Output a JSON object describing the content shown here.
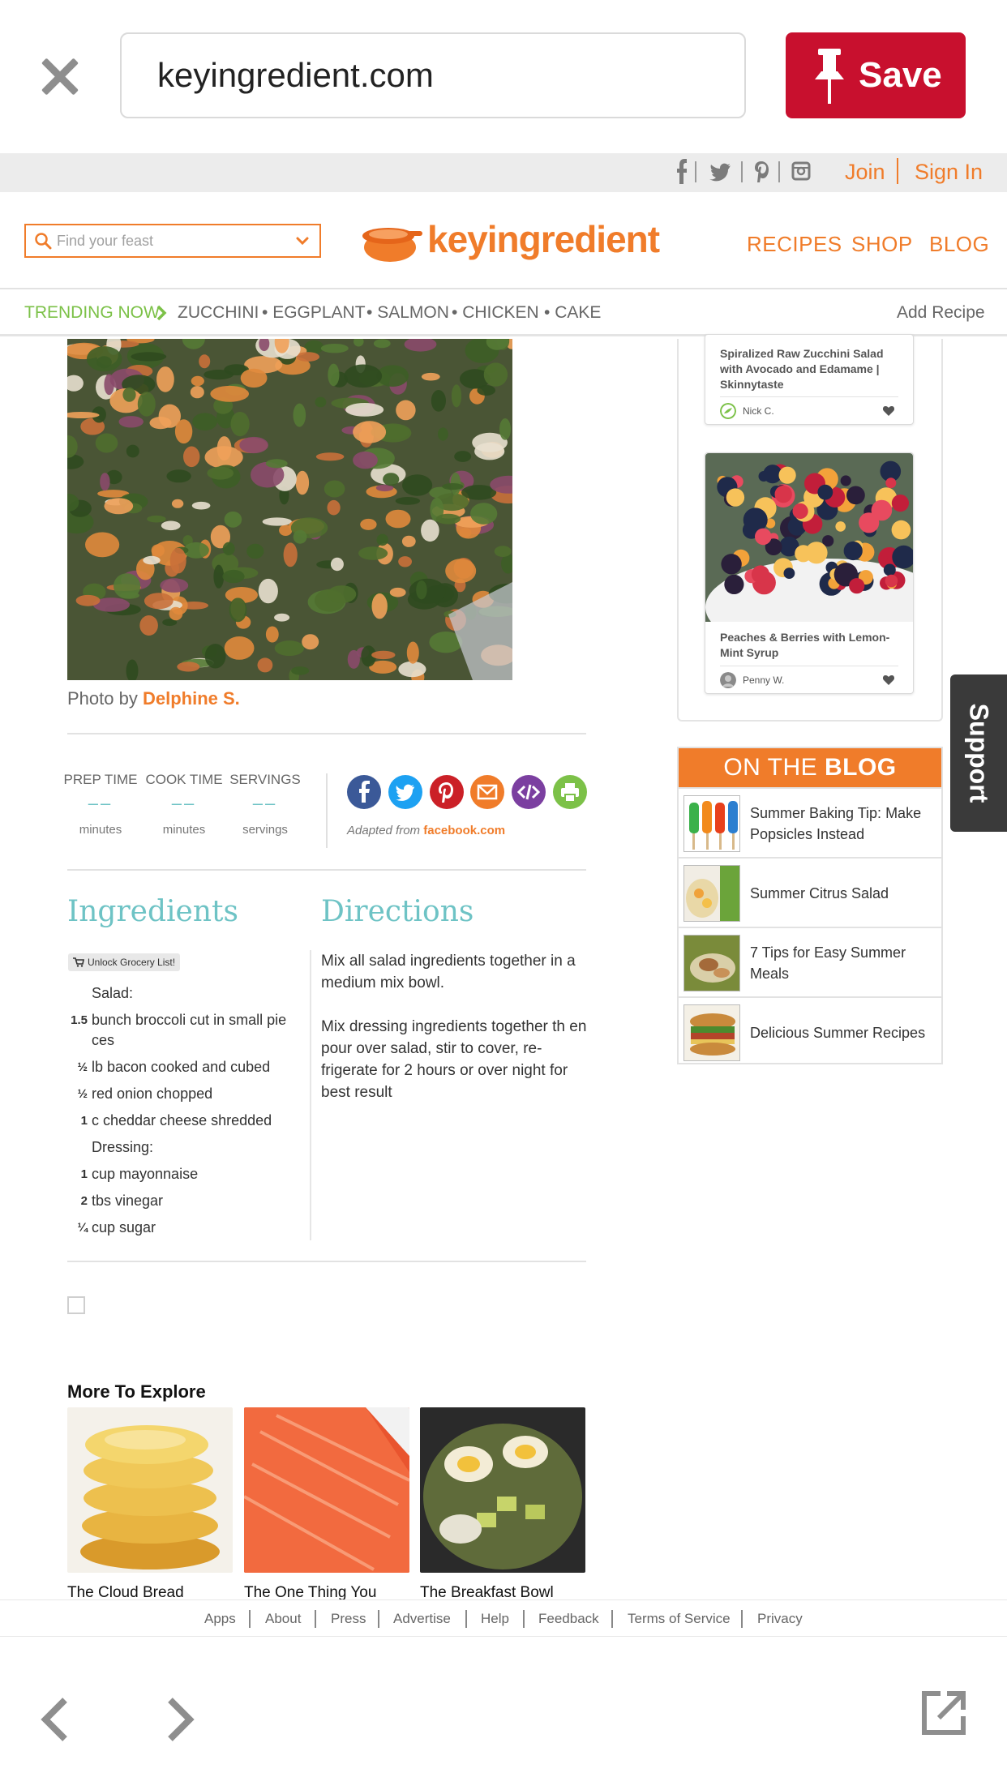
{
  "browser": {
    "url": "keyingredient.com",
    "save_label": "Save"
  },
  "account": {
    "join": "Join",
    "sign_in": "Sign In",
    "social_icons": [
      "facebook-icon",
      "twitter-icon",
      "pinterest-icon",
      "instagram-icon"
    ]
  },
  "header": {
    "search_placeholder": "Find your feast",
    "logo_text": "keyingredient",
    "nav": [
      "RECIPES",
      "SHOP",
      "BLOG"
    ]
  },
  "trending": {
    "label": "TRENDING NOW",
    "items": [
      "ZUCCHINI",
      "EGGPLANT",
      "SALMON",
      "CHICKEN",
      "CAKE"
    ],
    "add_recipe": "Add Recipe"
  },
  "recipe": {
    "photo_credit_prefix": "Photo by",
    "photo_credit_name": "Delphine S.",
    "times": [
      {
        "label": "PREP TIME",
        "value": "––",
        "unit": "minutes"
      },
      {
        "label": "COOK TIME",
        "value": "––",
        "unit": "minutes"
      },
      {
        "label": "SERVINGS",
        "value": "––",
        "unit": "servings"
      }
    ],
    "share_icons": [
      "facebook-icon",
      "twitter-icon",
      "pinterest-icon",
      "email-icon",
      "embed-icon",
      "print-icon"
    ],
    "share_colors": [
      "#3b5998",
      "#1da1f2",
      "#cb2027",
      "#f07c2a",
      "#7b3fa0",
      "#7cc148"
    ],
    "adapted_prefix": "Adapted from",
    "adapted_source": "facebook.com",
    "ingredients_heading": "Ingredients",
    "directions_heading": "Directions",
    "grocery_button": "Unlock Grocery List!",
    "ingredients": [
      {
        "qty": "",
        "text": "Salad:"
      },
      {
        "qty": "1.5",
        "text": "bunch broccoli cut in small pie ces"
      },
      {
        "qty": "½",
        "text": "lb bacon cooked and cubed"
      },
      {
        "qty": "½",
        "text": "red onion chopped"
      },
      {
        "qty": "1",
        "text": "c cheddar cheese shredded"
      },
      {
        "qty": "",
        "text": "Dressing:"
      },
      {
        "qty": "1",
        "text": "cup mayonnaise"
      },
      {
        "qty": "2",
        "text": "tbs vinegar"
      },
      {
        "qty": "¼",
        "text": "cup sugar"
      }
    ],
    "directions": [
      "Mix all salad ingredients together in a medium mix bowl.",
      "Mix dressing ingredients together th en pour over salad, stir to cover, re-frigerate for 2 hours or over night for best result"
    ]
  },
  "more": {
    "heading": "More To Explore",
    "items": [
      "The Cloud Bread",
      "The One Thing You",
      "The Breakfast Bowl"
    ]
  },
  "sidebar": {
    "cards": [
      {
        "title": "Spiralized Raw Zucchini Salad with Avocado and Edamame | Skinnytaste",
        "user": "Nick C."
      },
      {
        "title": "Peaches & Berries with Lemon-Mint Syrup",
        "user": "Penny W."
      }
    ],
    "blog_heading_light": "ON THE",
    "blog_heading_bold": "BLOG",
    "blog_posts": [
      "Summer Baking Tip: Make Popsicles Instead",
      "Summer Citrus Salad",
      "7 Tips for Easy Summer Meals",
      "Delicious Summer Recipes"
    ],
    "support_label": "Support"
  },
  "footer": {
    "links": [
      "Apps",
      "About",
      "Press",
      "Advertise",
      "Help",
      "Feedback",
      "Terms of Service",
      "Privacy"
    ]
  },
  "colors": {
    "brand_orange": "#f07c2a",
    "save_red": "#c8102e",
    "trending_green": "#7cc148",
    "heading_teal": "#6ec3c5"
  }
}
